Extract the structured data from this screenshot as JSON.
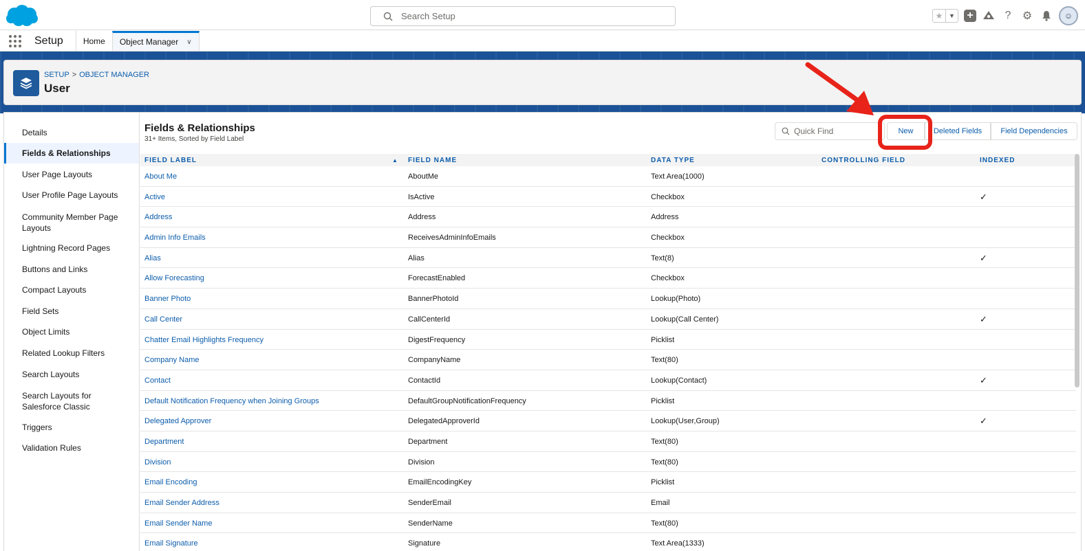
{
  "header": {
    "search_placeholder": "Search Setup",
    "avatar_initial": "☺"
  },
  "nav": {
    "app_name": "Setup",
    "tabs": [
      {
        "label": "Home"
      },
      {
        "label": "Object Manager"
      }
    ]
  },
  "page_header": {
    "breadcrumb_setup": "SETUP",
    "breadcrumb_sep": ">",
    "breadcrumb_object_manager": "OBJECT MANAGER",
    "title": "User"
  },
  "sidebar": {
    "items": [
      {
        "label": "Details"
      },
      {
        "label": "Fields & Relationships",
        "active": true
      },
      {
        "label": "User Page Layouts"
      },
      {
        "label": "User Profile Page Layouts"
      },
      {
        "label": "Community Member Page Layouts"
      },
      {
        "label": "Lightning Record Pages"
      },
      {
        "label": "Buttons and Links"
      },
      {
        "label": "Compact Layouts"
      },
      {
        "label": "Field Sets"
      },
      {
        "label": "Object Limits"
      },
      {
        "label": "Related Lookup Filters"
      },
      {
        "label": "Search Layouts"
      },
      {
        "label": "Search Layouts for Salesforce Classic"
      },
      {
        "label": "Triggers"
      },
      {
        "label": "Validation Rules"
      }
    ]
  },
  "section": {
    "title": "Fields & Relationships",
    "subtitle": "31+ Items, Sorted by Field Label",
    "quick_find_placeholder": "Quick Find",
    "btn_new": "New",
    "btn_deleted": "Deleted Fields",
    "btn_dependencies": "Field Dependencies"
  },
  "table": {
    "headers": {
      "field_label": "FIELD LABEL",
      "field_name": "FIELD NAME",
      "data_type": "DATA TYPE",
      "controlling_field": "CONTROLLING FIELD",
      "indexed": "INDEXED"
    },
    "rows": [
      {
        "label": "About Me",
        "name": "AboutMe",
        "type": "Text Area(1000)",
        "indexed": ""
      },
      {
        "label": "Active",
        "name": "IsActive",
        "type": "Checkbox",
        "indexed": "✓"
      },
      {
        "label": "Address",
        "name": "Address",
        "type": "Address",
        "indexed": ""
      },
      {
        "label": "Admin Info Emails",
        "name": "ReceivesAdminInfoEmails",
        "type": "Checkbox",
        "indexed": ""
      },
      {
        "label": "Alias",
        "name": "Alias",
        "type": "Text(8)",
        "indexed": "✓"
      },
      {
        "label": "Allow Forecasting",
        "name": "ForecastEnabled",
        "type": "Checkbox",
        "indexed": ""
      },
      {
        "label": "Banner Photo",
        "name": "BannerPhotoId",
        "type": "Lookup(Photo)",
        "indexed": ""
      },
      {
        "label": "Call Center",
        "name": "CallCenterId",
        "type": "Lookup(Call Center)",
        "indexed": "✓"
      },
      {
        "label": "Chatter Email Highlights Frequency",
        "name": "DigestFrequency",
        "type": "Picklist",
        "indexed": ""
      },
      {
        "label": "Company Name",
        "name": "CompanyName",
        "type": "Text(80)",
        "indexed": ""
      },
      {
        "label": "Contact",
        "name": "ContactId",
        "type": "Lookup(Contact)",
        "indexed": "✓"
      },
      {
        "label": "Default Notification Frequency when Joining Groups",
        "name": "DefaultGroupNotificationFrequency",
        "type": "Picklist",
        "indexed": ""
      },
      {
        "label": "Delegated Approver",
        "name": "DelegatedApproverId",
        "type": "Lookup(User,Group)",
        "indexed": "✓"
      },
      {
        "label": "Department",
        "name": "Department",
        "type": "Text(80)",
        "indexed": ""
      },
      {
        "label": "Division",
        "name": "Division",
        "type": "Text(80)",
        "indexed": ""
      },
      {
        "label": "Email Encoding",
        "name": "EmailEncodingKey",
        "type": "Picklist",
        "indexed": ""
      },
      {
        "label": "Email Sender Address",
        "name": "SenderEmail",
        "type": "Email",
        "indexed": ""
      },
      {
        "label": "Email Sender Name",
        "name": "SenderName",
        "type": "Text(80)",
        "indexed": ""
      },
      {
        "label": "Email Signature",
        "name": "Signature",
        "type": "Text Area(1333)",
        "indexed": ""
      }
    ]
  },
  "colors": {
    "brand_blue": "#0176d3",
    "link_blue": "#0b5cab",
    "band_blue": "#1b5297",
    "annotation_red": "#e8231a"
  }
}
